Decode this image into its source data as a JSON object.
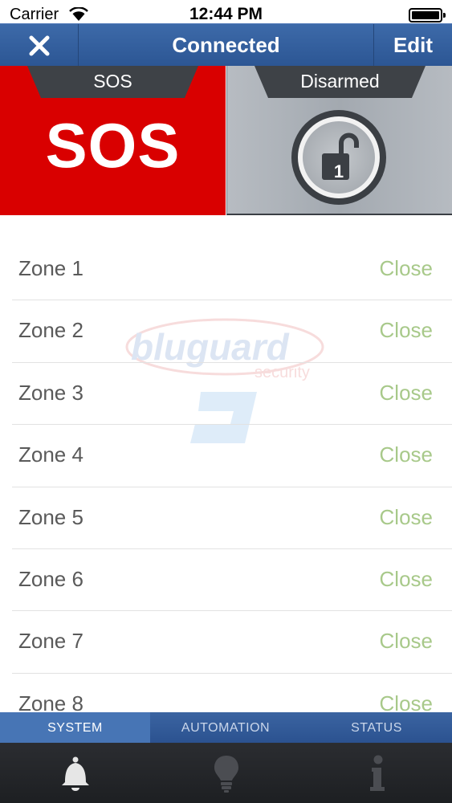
{
  "status_bar": {
    "carrier": "Carrier",
    "time": "12:44 PM"
  },
  "nav": {
    "title": "Connected",
    "edit_label": "Edit",
    "close_icon": "close-icon"
  },
  "panels": {
    "sos": {
      "tab_label": "SOS",
      "big_label": "SOS",
      "color": "#d90000"
    },
    "arm": {
      "tab_label": "Disarmed",
      "partition_number": "1",
      "icon": "unlocked-padlock-icon"
    }
  },
  "zones": [
    {
      "name": "Zone 1",
      "status": "Close"
    },
    {
      "name": "Zone 2",
      "status": "Close"
    },
    {
      "name": "Zone 3",
      "status": "Close"
    },
    {
      "name": "Zone 4",
      "status": "Close"
    },
    {
      "name": "Zone 5",
      "status": "Close"
    },
    {
      "name": "Zone 6",
      "status": "Close"
    },
    {
      "name": "Zone 7",
      "status": "Close"
    },
    {
      "name": "Zone 8",
      "status": "Close"
    }
  ],
  "watermark": {
    "brand": "bluguard",
    "sub": "security"
  },
  "tabs": {
    "segments": [
      {
        "label": "SYSTEM",
        "active": true
      },
      {
        "label": "AUTOMATION",
        "active": false
      },
      {
        "label": "STATUS",
        "active": false
      }
    ],
    "icons": [
      "bell-icon",
      "lightbulb-icon",
      "info-icon"
    ]
  },
  "colors": {
    "nav_blue": "#2c5694",
    "sos_red": "#d90000",
    "status_green": "#a8c98a"
  }
}
